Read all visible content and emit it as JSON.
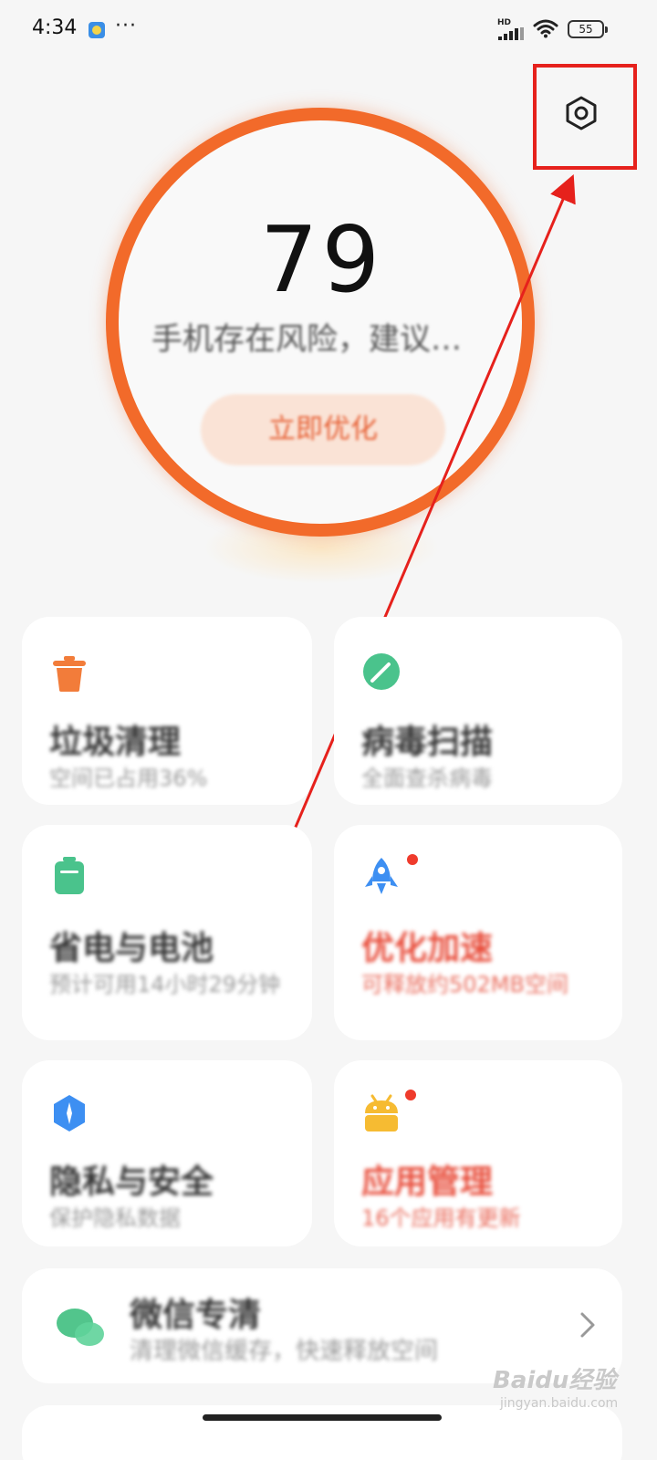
{
  "status_bar": {
    "time": "4:34",
    "more": "···",
    "network": "HD",
    "battery": "55"
  },
  "score": {
    "value": "79",
    "description": "手机存在风险，建议…",
    "button": "立即优化",
    "ring_color": "#f26a2a"
  },
  "cards": [
    {
      "title": "垃圾清理",
      "subtitle": "空间已占用36%",
      "icon": "trash-icon",
      "color": "#f27c3a"
    },
    {
      "title": "病毒扫描",
      "subtitle": "全面查杀病毒",
      "icon": "scan-icon",
      "color": "#4ac38c"
    },
    {
      "title": "省电与电池",
      "subtitle": "预计可用14小时29分钟",
      "icon": "battery-icon",
      "color": "#4ac38c"
    },
    {
      "title": "优化加速",
      "subtitle": "可释放约502MB空间",
      "icon": "rocket-icon",
      "color": "#3d8ff2",
      "alert": true
    },
    {
      "title": "隐私与安全",
      "subtitle": "保护隐私数据",
      "icon": "shield-icon",
      "color": "#3d8ff2"
    },
    {
      "title": "应用管理",
      "subtitle": "16个应用有更新",
      "icon": "android-icon",
      "color": "#f6bb32",
      "alert": true
    }
  ],
  "wide_card": {
    "title": "微信专清",
    "subtitle": "清理微信缓存，快速释放空间"
  },
  "watermark": {
    "brand": "Baidu经验",
    "url": "jingyan.baidu.com"
  },
  "colors": {
    "accent": "#f26a2a",
    "highlight": "#e6211c",
    "alert": "#e84e3c"
  }
}
